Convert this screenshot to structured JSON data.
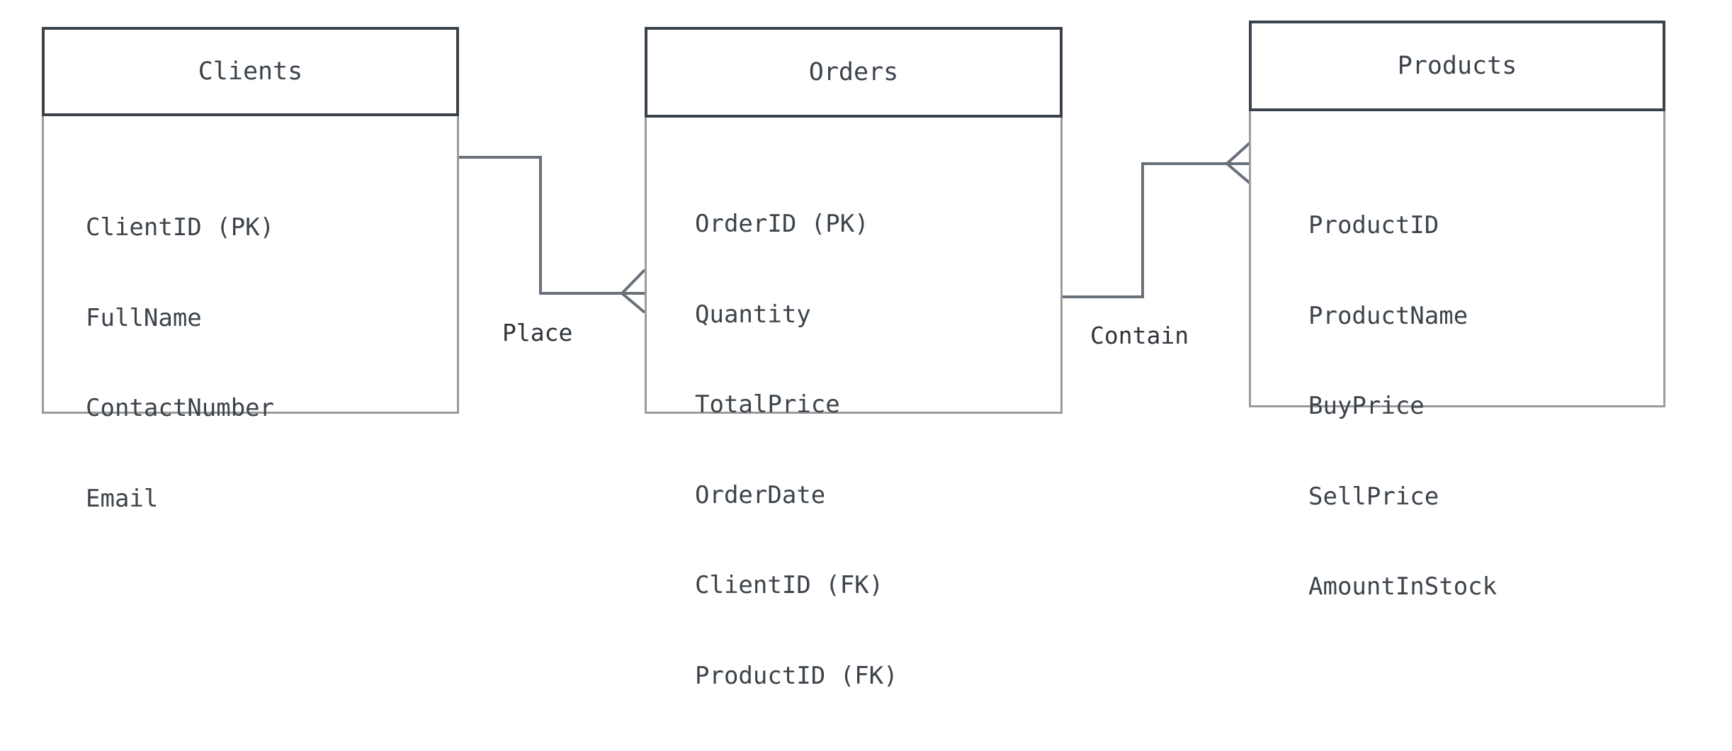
{
  "diagram": {
    "entities": [
      {
        "key": "clients",
        "name": "Clients",
        "attributes": [
          "ClientID (PK)",
          "FullName",
          "ContactNumber",
          "Email"
        ]
      },
      {
        "key": "orders",
        "name": "Orders",
        "attributes": [
          "OrderID (PK)",
          "Quantity",
          "TotalPrice",
          "OrderDate",
          "ClientID (FK)",
          "ProductID (FK)"
        ]
      },
      {
        "key": "products",
        "name": "Products",
        "attributes": [
          "ProductID",
          "ProductName",
          "BuyPrice",
          "SellPrice",
          "AmountInStock"
        ]
      }
    ],
    "relationships": [
      {
        "key": "place",
        "label": "Place",
        "from": "Clients",
        "to": "Orders",
        "from_cardinality": "one",
        "to_cardinality": "many"
      },
      {
        "key": "contain",
        "label": "Contain",
        "from": "Orders",
        "to": "Products",
        "from_cardinality": "one",
        "to_cardinality": "many"
      }
    ],
    "colors": {
      "header_border": "#3a434b",
      "body_border": "#9b9b9b",
      "connector": "#68707a",
      "text": "#3c434b"
    }
  }
}
